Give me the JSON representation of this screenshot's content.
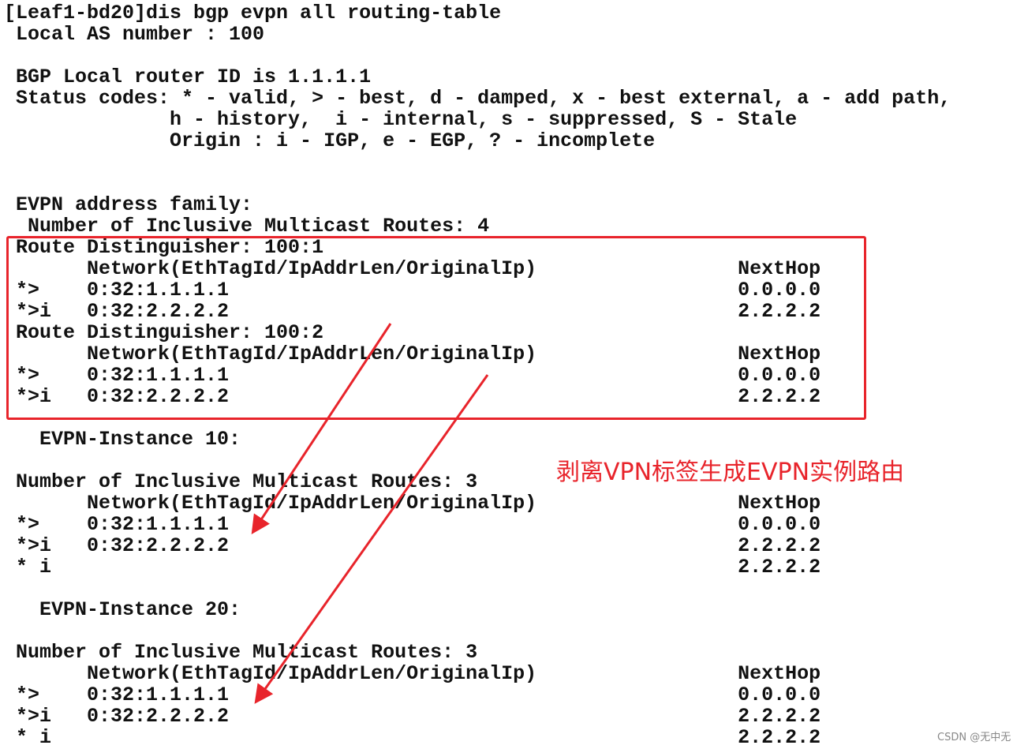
{
  "terminal": {
    "lines": [
      "[Leaf1-bd20]dis bgp evpn all routing-table",
      " Local AS number : 100",
      "",
      " BGP Local router ID is 1.1.1.1",
      " Status codes: * - valid, > - best, d - damped, x - best external, a - add path,",
      "              h - history,  i - internal, s - suppressed, S - Stale",
      "              Origin : i - IGP, e - EGP, ? - incomplete",
      "",
      "",
      " EVPN address family:",
      "  Number of Inclusive Multicast Routes: 4",
      " Route Distinguisher: 100:1",
      "       Network(EthTagId/IpAddrLen/OriginalIp)                 NextHop",
      " *>    0:32:1.1.1.1                                           0.0.0.0",
      " *>i   0:32:2.2.2.2                                           2.2.2.2",
      " Route Distinguisher: 100:2",
      "       Network(EthTagId/IpAddrLen/OriginalIp)                 NextHop",
      " *>    0:32:1.1.1.1                                           0.0.0.0",
      " *>i   0:32:2.2.2.2                                           2.2.2.2",
      "",
      "   EVPN-Instance 10:",
      "",
      " Number of Inclusive Multicast Routes: 3",
      "       Network(EthTagId/IpAddrLen/OriginalIp)                 NextHop",
      " *>    0:32:1.1.1.1                                           0.0.0.0",
      " *>i   0:32:2.2.2.2                                           2.2.2.2",
      " * i                                                          2.2.2.2",
      "",
      "   EVPN-Instance 20:",
      "",
      " Number of Inclusive Multicast Routes: 3",
      "       Network(EthTagId/IpAddrLen/OriginalIp)                 NextHop",
      " *>    0:32:1.1.1.1                                           0.0.0.0",
      " *>i   0:32:2.2.2.2                                           2.2.2.2",
      " * i                                                          2.2.2.2"
    ]
  },
  "annotation": {
    "note": "剥离VPN标签生成EVPN实例路由",
    "color": "#e8242b"
  },
  "watermark": "CSDN @无中无"
}
